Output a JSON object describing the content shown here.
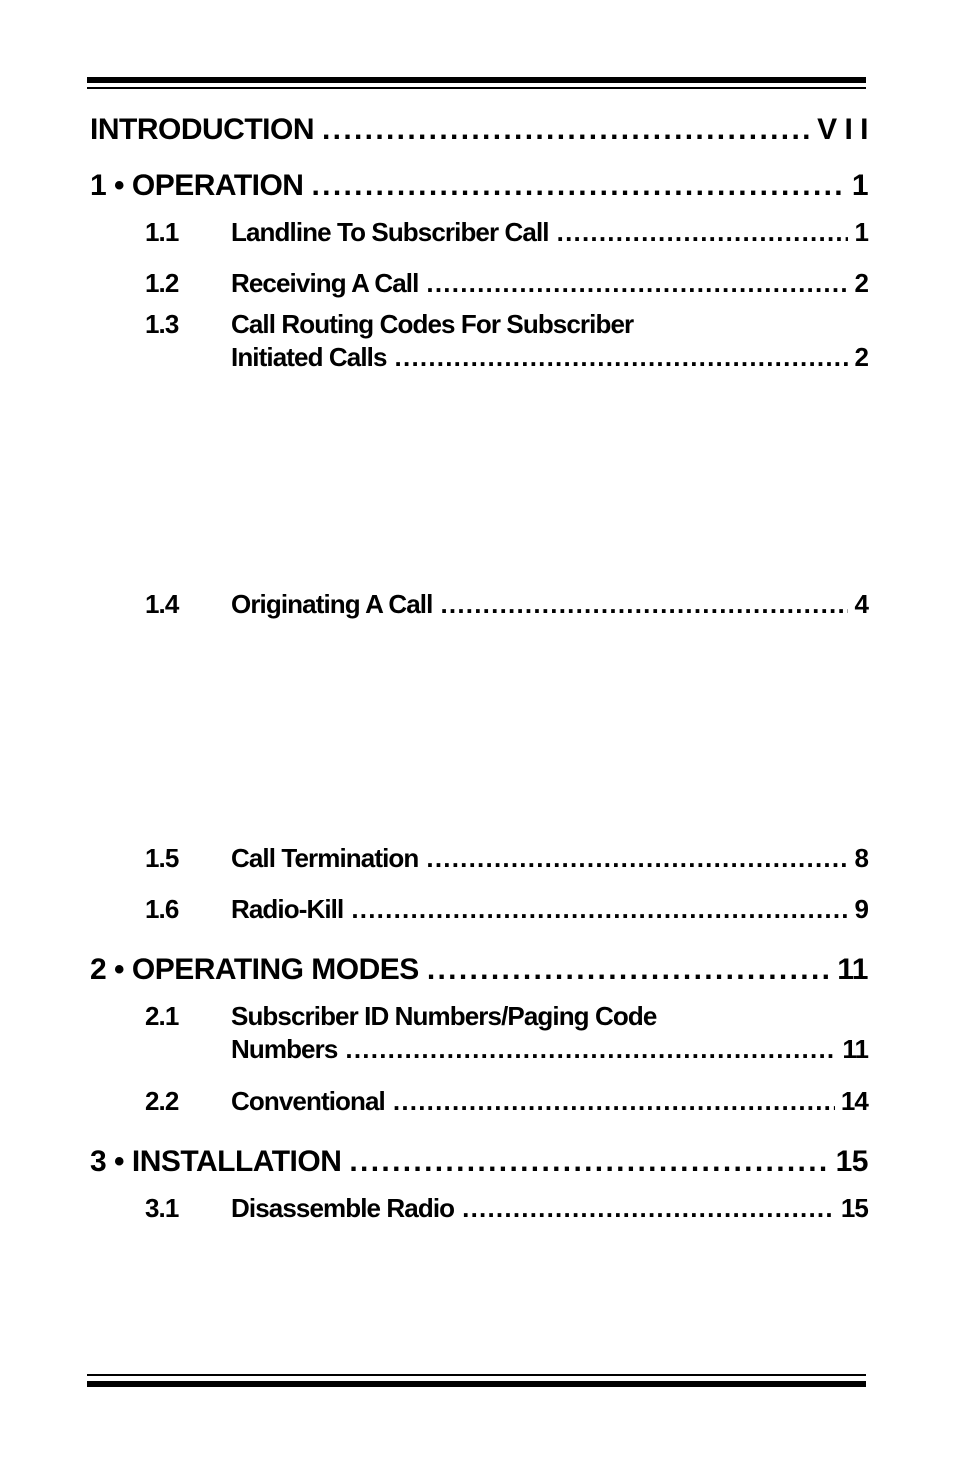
{
  "toc": {
    "introduction": {
      "title": "INTRODUCTION",
      "page": "V I I"
    },
    "chapters": [
      {
        "title": "1 • OPERATION",
        "page": "1",
        "sections": [
          {
            "num": "1.1",
            "title": "Landline To Subscriber Call",
            "page": "1"
          },
          {
            "num": "1.2",
            "title": "Receiving A Call",
            "page": "2"
          },
          {
            "num": "1.3",
            "title_line1": "Call Routing Codes For Subscriber",
            "title": "Initiated Calls",
            "page": "2"
          },
          {
            "num": "1.4",
            "title": "Originating A Call",
            "page": "4"
          },
          {
            "num": "1.5",
            "title": "Call Termination",
            "page": "8"
          },
          {
            "num": "1.6",
            "title": "Radio-Kill",
            "page": "9"
          }
        ]
      },
      {
        "title": "2 • OPERATING MODES",
        "page": "11",
        "sections": [
          {
            "num": "2.1",
            "title_line1": "Subscriber ID Numbers/Paging Code",
            "title": "Numbers",
            "page": "11"
          },
          {
            "num": "2.2",
            "title": "Conventional",
            "page": "14"
          }
        ]
      },
      {
        "title": "3 • INSTALLATION",
        "page": "15",
        "sections": [
          {
            "num": "3.1",
            "title": "Disassemble Radio",
            "page": "15"
          }
        ]
      }
    ]
  }
}
